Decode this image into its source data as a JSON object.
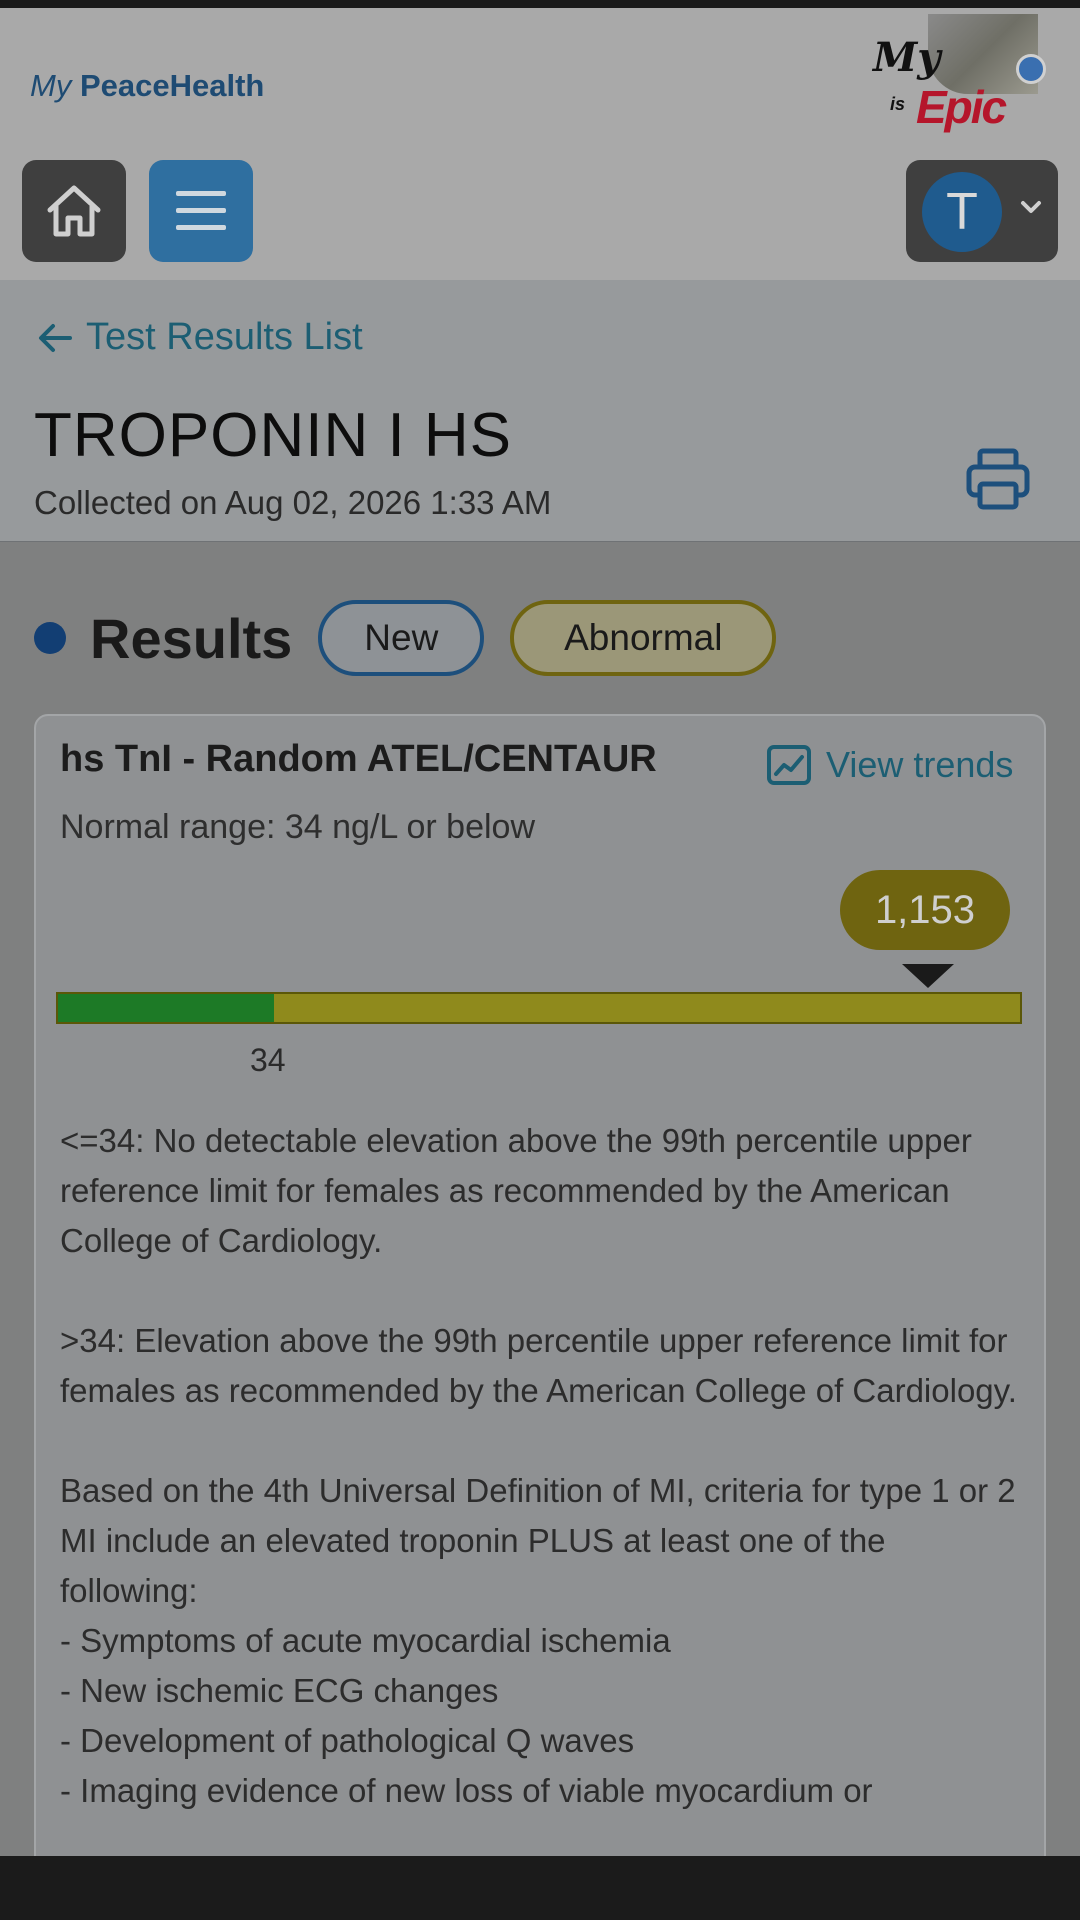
{
  "header": {
    "logo_my": "My",
    "logo_brand": "PeaceHealth",
    "epic_my": "My",
    "epic_is": "is",
    "epic_word": "Epic",
    "avatar_initial": "T"
  },
  "page": {
    "back_label": "Test Results List",
    "title": "TROPONIN I HS",
    "collected": "Collected on Aug 02, 2026 1:33 AM"
  },
  "results": {
    "heading": "Results",
    "badges": {
      "new": "New",
      "abnormal": "Abnormal"
    }
  },
  "card": {
    "test_name": "hs TnI - Random ATEL/CENTAUR",
    "view_trends": "View trends",
    "normal_range": "Normal range: 34 ng/L or below",
    "value": "1,153",
    "range_tick": "34",
    "normal_fraction": 0.225,
    "value_fraction": 0.9,
    "body": "<=34: No detectable elevation above the 99th percentile upper reference limit for females as recommended by the American College of Cardiology.\n\n>34: Elevation above the 99th percentile upper reference limit for females as recommended by the American College of Cardiology.\n\nBased on the 4th Universal Definition of MI, criteria for type 1 or 2 MI include an elevated troponin PLUS at least one of the following:\n- Symptoms of acute myocardial ischemia\n- New ischemic ECG changes\n- Development of pathological Q waves\n- Imaging evidence of new loss of viable myocardium or"
  },
  "colors": {
    "normal": "#1d7a26",
    "abnormal": "#8f8a1c",
    "link": "#1c5e73",
    "brand": "#1e4b73"
  }
}
